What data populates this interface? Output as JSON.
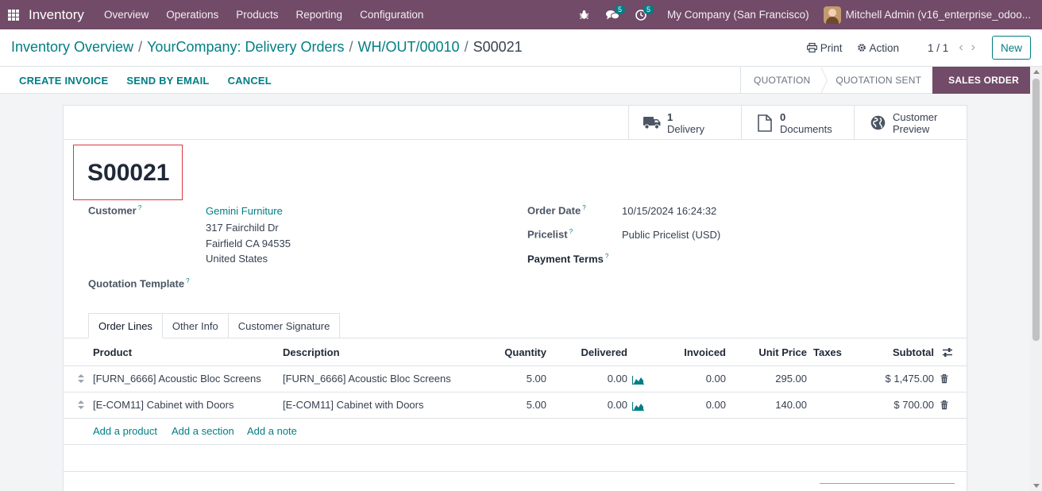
{
  "navbar": {
    "app_name": "Inventory",
    "menu": [
      "Overview",
      "Operations",
      "Products",
      "Reporting",
      "Configuration"
    ],
    "messages_count": "5",
    "activities_count": "5",
    "company": "My Company (San Francisco)",
    "user": "Mitchell Admin (v16_enterprise_odoo..."
  },
  "breadcrumb": {
    "items": [
      "Inventory Overview",
      "YourCompany: Delivery Orders",
      "WH/OUT/00010"
    ],
    "current": "S00021",
    "separator": "/"
  },
  "control": {
    "print_label": "Print",
    "action_label": "Action",
    "pager": "1 / 1",
    "new_label": "New"
  },
  "statusbar": {
    "actions": [
      "CREATE INVOICE",
      "SEND BY EMAIL",
      "CANCEL"
    ],
    "stages": [
      "QUOTATION",
      "QUOTATION SENT",
      "SALES ORDER"
    ],
    "current_stage": "SALES ORDER"
  },
  "smart_buttons": [
    {
      "value": "1",
      "label": "Delivery",
      "icon": "truck-icon"
    },
    {
      "value": "0",
      "label": "Documents",
      "icon": "document-icon"
    },
    {
      "value": "Customer",
      "label": "Preview",
      "icon": "globe-icon"
    }
  ],
  "record": {
    "name": "S00021",
    "customer_label": "Customer",
    "customer_name": "Gemini Furniture",
    "address_line1": "317 Fairchild Dr",
    "address_line2": "Fairfield CA 94535",
    "address_line3": "United States",
    "template_label": "Quotation Template",
    "order_date_label": "Order Date",
    "order_date": "10/15/2024 16:24:32",
    "pricelist_label": "Pricelist",
    "pricelist": "Public Pricelist (USD)",
    "payment_terms_label": "Payment Terms",
    "help_mark": "?"
  },
  "tabs": [
    "Order Lines",
    "Other Info",
    "Customer Signature"
  ],
  "table": {
    "columns": [
      "Product",
      "Description",
      "Quantity",
      "Delivered",
      "Invoiced",
      "Unit Price",
      "Taxes",
      "Subtotal"
    ],
    "rows": [
      {
        "product": "[FURN_6666] Acoustic Bloc Screens",
        "description": "[FURN_6666] Acoustic Bloc Screens",
        "quantity": "5.00",
        "delivered": "0.00",
        "invoiced": "0.00",
        "unit_price": "295.00",
        "taxes": "",
        "subtotal": "$ 1,475.00"
      },
      {
        "product": "[E-COM11] Cabinet with Doors",
        "description": "[E-COM11] Cabinet with Doors",
        "quantity": "5.00",
        "delivered": "0.00",
        "invoiced": "0.00",
        "unit_price": "140.00",
        "taxes": "",
        "subtotal": "$ 700.00"
      }
    ],
    "add_links": [
      "Add a product",
      "Add a section",
      "Add a note"
    ]
  },
  "colors": {
    "brand": "#714b67",
    "accent": "#017e84",
    "highlight_border": "#dc3545"
  }
}
